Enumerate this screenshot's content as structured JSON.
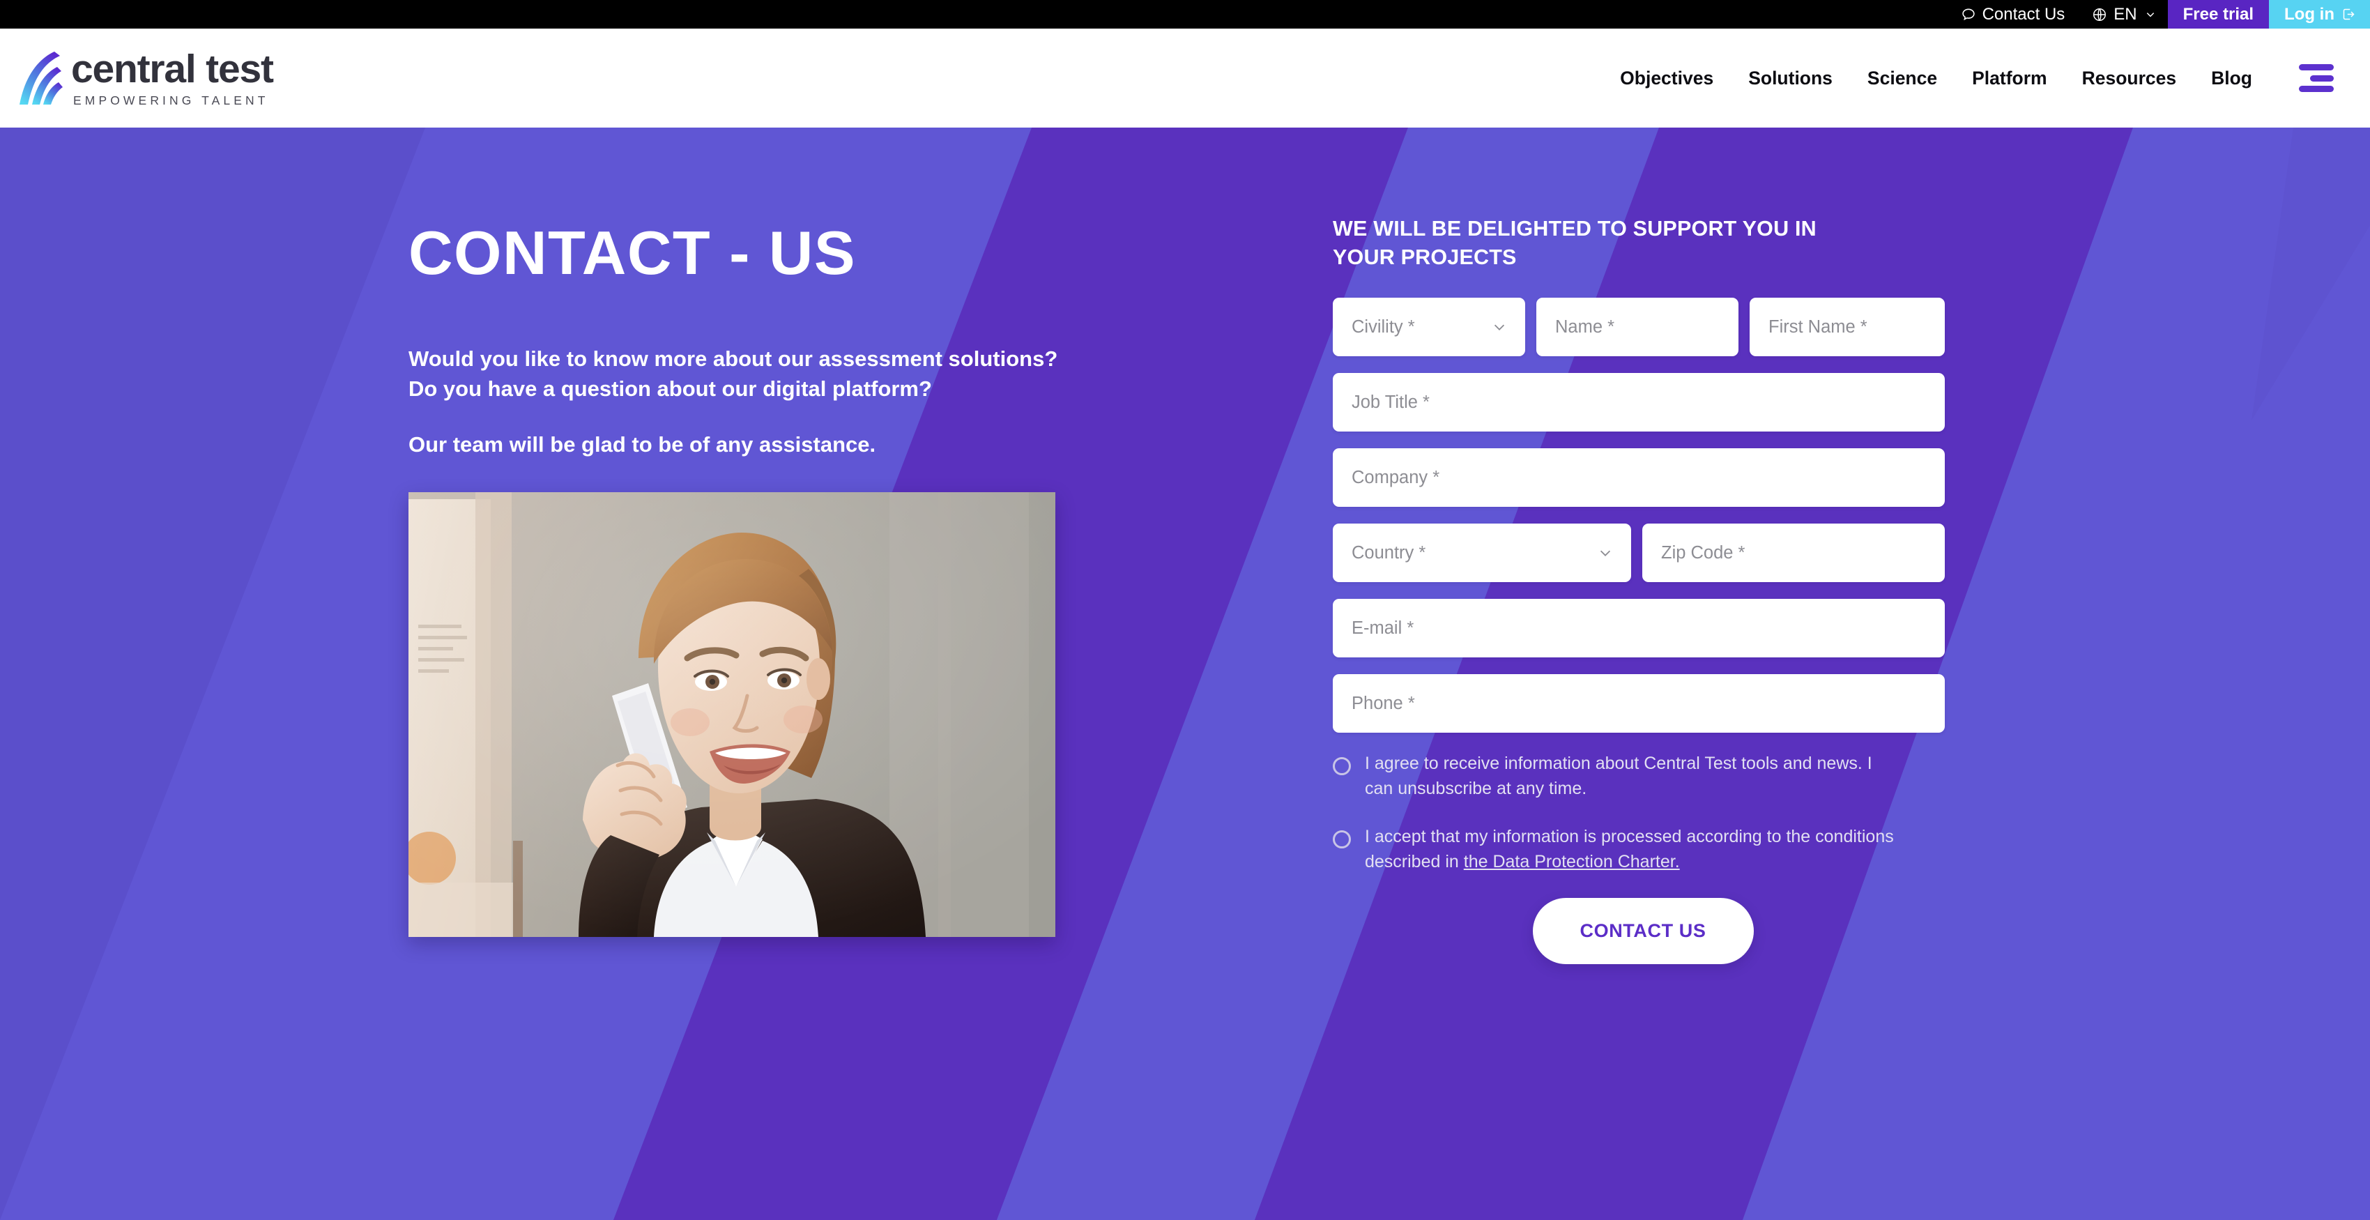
{
  "topbar": {
    "contact_label": "Contact Us",
    "lang_label": "EN",
    "free_trial_label": "Free trial",
    "login_label": "Log in",
    "colors": {
      "free_trial_bg": "#5925C2",
      "login_bg": "#57D3F2",
      "bar_bg": "#000000"
    }
  },
  "header": {
    "logo_name": "central test",
    "logo_tagline": "EMPOWERING TALENT",
    "nav": [
      {
        "label": "Objectives"
      },
      {
        "label": "Solutions"
      },
      {
        "label": "Science"
      },
      {
        "label": "Platform"
      },
      {
        "label": "Resources"
      },
      {
        "label": "Blog"
      }
    ]
  },
  "hero": {
    "title": "CONTACT - US",
    "subtitle_line1": "Would you like to know more about our assessment solutions?",
    "subtitle_line2": "Do you have a question about our digital platform?",
    "subtitle_line3": "Our team will be glad to be of any assistance.",
    "photo_alt": "Smiling businesswoman talking on a mobile phone",
    "background_color": "#5B4FCB",
    "band_colors": [
      "#5B4FCB",
      "#5B54CE",
      "#5B31BE",
      "#6258D6"
    ]
  },
  "form": {
    "heading_line1": "WE WILL BE DELIGHTED TO SUPPORT YOU IN",
    "heading_line2": "YOUR PROJECTS",
    "fields": {
      "civility": "Civility *",
      "name": "Name *",
      "first_name": "First Name *",
      "job_title": "Job Title *",
      "company": "Company *",
      "country": "Country *",
      "zip_code": "Zip Code *",
      "email": "E-mail *",
      "phone": "Phone *"
    },
    "consent_1": "I agree to receive information about Central Test tools and news. I can unsubscribe at any time.",
    "consent_2_before": "I accept that my information is processed according to the conditions described in ",
    "consent_2_link": "the Data Protection Charter.",
    "submit_label": "CONTACT US",
    "submit_text_color": "#5B2DC7"
  }
}
